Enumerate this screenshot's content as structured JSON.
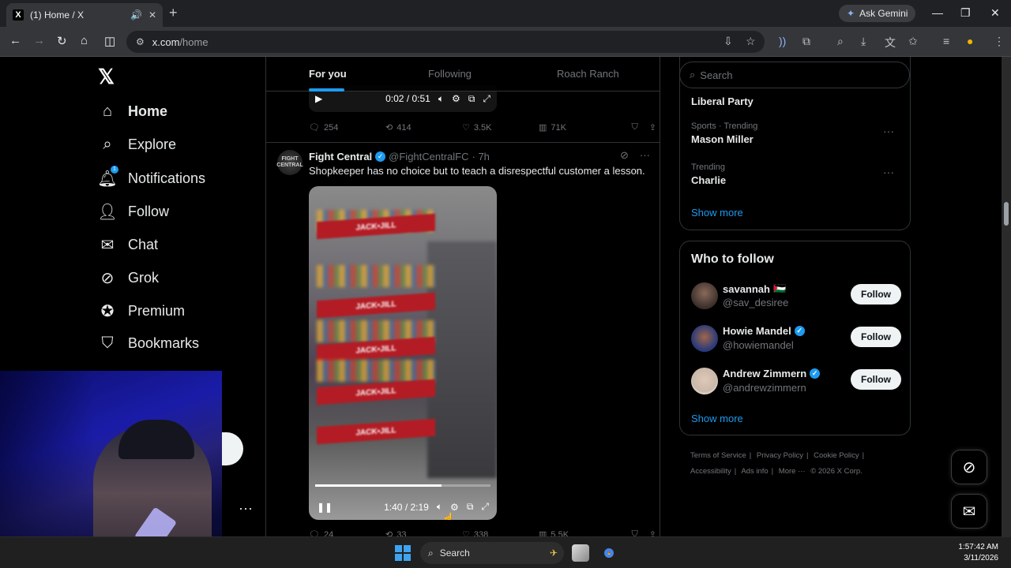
{
  "browser": {
    "tab_title": "(1) Home / X",
    "tab_favicon": "X",
    "url_host": "x.com",
    "url_path": "/home",
    "ask_gemini": "Ask Gemini"
  },
  "left_nav": {
    "items": [
      {
        "label": "Home",
        "icon": "home-icon"
      },
      {
        "label": "Explore",
        "icon": "search-icon"
      },
      {
        "label": "Notifications",
        "icon": "bell-icon",
        "badge": "1"
      },
      {
        "label": "Follow",
        "icon": "add-person-icon"
      },
      {
        "label": "Chat",
        "icon": "envelope-icon"
      },
      {
        "label": "Grok",
        "icon": "grok-icon"
      },
      {
        "label": "Premium",
        "icon": "verified-badge-icon"
      },
      {
        "label": "Bookmarks",
        "icon": "bookmark-icon"
      }
    ]
  },
  "feed": {
    "tabs": [
      "For you",
      "Following",
      "Roach Ranch"
    ],
    "prev_video": {
      "time": "0:02 / 0:51"
    },
    "prev_actions": {
      "replies": "254",
      "reposts": "414",
      "likes": "3.5K",
      "views": "71K"
    },
    "post": {
      "avatar_text": "FIGHT CENTRAL",
      "name": "Fight Central",
      "handle": "@FightCentralFC",
      "time": "· 7h",
      "text": "Shopkeeper has no choice but to teach a disrespectful customer a lesson.",
      "video_time": "1:40 / 2:19",
      "video_progress": 0.72,
      "shelf_label": "JACK•JILL",
      "actions": {
        "replies": "24",
        "reposts": "33",
        "likes": "338",
        "views": "5.5K"
      }
    }
  },
  "right": {
    "search_placeholder": "Search",
    "trends": [
      {
        "context": "",
        "title": "Liberal Party"
      },
      {
        "context": "Sports · Trending",
        "title": "Mason Miller"
      },
      {
        "context": "Trending",
        "title": "Charlie"
      }
    ],
    "show_more": "Show more",
    "who_to_follow": {
      "title": "Who to follow",
      "users": [
        {
          "name": "savannah",
          "flag": "🇵🇸",
          "handle": "@sav_desiree",
          "verified": false,
          "color": "#3a2f2a"
        },
        {
          "name": "Howie Mandel",
          "flag": "",
          "handle": "@howiemandel",
          "verified": true,
          "color": "#2a3a7a"
        },
        {
          "name": "Andrew Zimmern",
          "flag": "",
          "handle": "@andrewzimmern",
          "verified": true,
          "color": "#c9b8a8"
        }
      ],
      "follow_label": "Follow",
      "show_more": "Show more"
    },
    "footer": [
      "Terms of Service",
      "|",
      "Privacy Policy",
      "|",
      "Cookie Policy",
      "|",
      "Accessibility",
      "|",
      "Ads info",
      "|",
      "More ···",
      "© 2026 X Corp."
    ]
  },
  "taskbar": {
    "search": "Search",
    "time": "1:57:42 AM",
    "date": "3/11/2026"
  }
}
